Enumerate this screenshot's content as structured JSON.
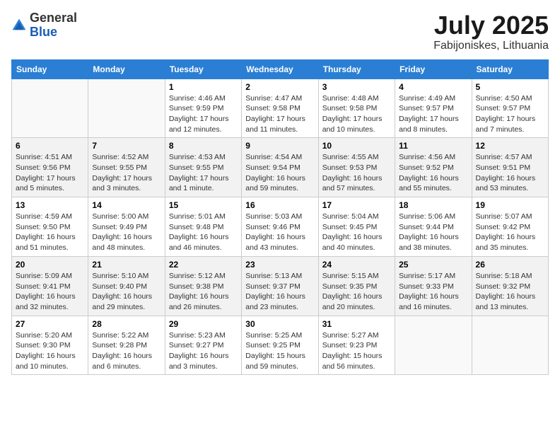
{
  "header": {
    "logo_general": "General",
    "logo_blue": "Blue",
    "title": "July 2025",
    "location": "Fabijoniskes, Lithuania"
  },
  "weekdays": [
    "Sunday",
    "Monday",
    "Tuesday",
    "Wednesday",
    "Thursday",
    "Friday",
    "Saturday"
  ],
  "weeks": [
    [
      {
        "num": "",
        "detail": ""
      },
      {
        "num": "",
        "detail": ""
      },
      {
        "num": "1",
        "detail": "Sunrise: 4:46 AM\nSunset: 9:59 PM\nDaylight: 17 hours and 12 minutes."
      },
      {
        "num": "2",
        "detail": "Sunrise: 4:47 AM\nSunset: 9:58 PM\nDaylight: 17 hours and 11 minutes."
      },
      {
        "num": "3",
        "detail": "Sunrise: 4:48 AM\nSunset: 9:58 PM\nDaylight: 17 hours and 10 minutes."
      },
      {
        "num": "4",
        "detail": "Sunrise: 4:49 AM\nSunset: 9:57 PM\nDaylight: 17 hours and 8 minutes."
      },
      {
        "num": "5",
        "detail": "Sunrise: 4:50 AM\nSunset: 9:57 PM\nDaylight: 17 hours and 7 minutes."
      }
    ],
    [
      {
        "num": "6",
        "detail": "Sunrise: 4:51 AM\nSunset: 9:56 PM\nDaylight: 17 hours and 5 minutes."
      },
      {
        "num": "7",
        "detail": "Sunrise: 4:52 AM\nSunset: 9:55 PM\nDaylight: 17 hours and 3 minutes."
      },
      {
        "num": "8",
        "detail": "Sunrise: 4:53 AM\nSunset: 9:55 PM\nDaylight: 17 hours and 1 minute."
      },
      {
        "num": "9",
        "detail": "Sunrise: 4:54 AM\nSunset: 9:54 PM\nDaylight: 16 hours and 59 minutes."
      },
      {
        "num": "10",
        "detail": "Sunrise: 4:55 AM\nSunset: 9:53 PM\nDaylight: 16 hours and 57 minutes."
      },
      {
        "num": "11",
        "detail": "Sunrise: 4:56 AM\nSunset: 9:52 PM\nDaylight: 16 hours and 55 minutes."
      },
      {
        "num": "12",
        "detail": "Sunrise: 4:57 AM\nSunset: 9:51 PM\nDaylight: 16 hours and 53 minutes."
      }
    ],
    [
      {
        "num": "13",
        "detail": "Sunrise: 4:59 AM\nSunset: 9:50 PM\nDaylight: 16 hours and 51 minutes."
      },
      {
        "num": "14",
        "detail": "Sunrise: 5:00 AM\nSunset: 9:49 PM\nDaylight: 16 hours and 48 minutes."
      },
      {
        "num": "15",
        "detail": "Sunrise: 5:01 AM\nSunset: 9:48 PM\nDaylight: 16 hours and 46 minutes."
      },
      {
        "num": "16",
        "detail": "Sunrise: 5:03 AM\nSunset: 9:46 PM\nDaylight: 16 hours and 43 minutes."
      },
      {
        "num": "17",
        "detail": "Sunrise: 5:04 AM\nSunset: 9:45 PM\nDaylight: 16 hours and 40 minutes."
      },
      {
        "num": "18",
        "detail": "Sunrise: 5:06 AM\nSunset: 9:44 PM\nDaylight: 16 hours and 38 minutes."
      },
      {
        "num": "19",
        "detail": "Sunrise: 5:07 AM\nSunset: 9:42 PM\nDaylight: 16 hours and 35 minutes."
      }
    ],
    [
      {
        "num": "20",
        "detail": "Sunrise: 5:09 AM\nSunset: 9:41 PM\nDaylight: 16 hours and 32 minutes."
      },
      {
        "num": "21",
        "detail": "Sunrise: 5:10 AM\nSunset: 9:40 PM\nDaylight: 16 hours and 29 minutes."
      },
      {
        "num": "22",
        "detail": "Sunrise: 5:12 AM\nSunset: 9:38 PM\nDaylight: 16 hours and 26 minutes."
      },
      {
        "num": "23",
        "detail": "Sunrise: 5:13 AM\nSunset: 9:37 PM\nDaylight: 16 hours and 23 minutes."
      },
      {
        "num": "24",
        "detail": "Sunrise: 5:15 AM\nSunset: 9:35 PM\nDaylight: 16 hours and 20 minutes."
      },
      {
        "num": "25",
        "detail": "Sunrise: 5:17 AM\nSunset: 9:33 PM\nDaylight: 16 hours and 16 minutes."
      },
      {
        "num": "26",
        "detail": "Sunrise: 5:18 AM\nSunset: 9:32 PM\nDaylight: 16 hours and 13 minutes."
      }
    ],
    [
      {
        "num": "27",
        "detail": "Sunrise: 5:20 AM\nSunset: 9:30 PM\nDaylight: 16 hours and 10 minutes."
      },
      {
        "num": "28",
        "detail": "Sunrise: 5:22 AM\nSunset: 9:28 PM\nDaylight: 16 hours and 6 minutes."
      },
      {
        "num": "29",
        "detail": "Sunrise: 5:23 AM\nSunset: 9:27 PM\nDaylight: 16 hours and 3 minutes."
      },
      {
        "num": "30",
        "detail": "Sunrise: 5:25 AM\nSunset: 9:25 PM\nDaylight: 15 hours and 59 minutes."
      },
      {
        "num": "31",
        "detail": "Sunrise: 5:27 AM\nSunset: 9:23 PM\nDaylight: 15 hours and 56 minutes."
      },
      {
        "num": "",
        "detail": ""
      },
      {
        "num": "",
        "detail": ""
      }
    ]
  ]
}
